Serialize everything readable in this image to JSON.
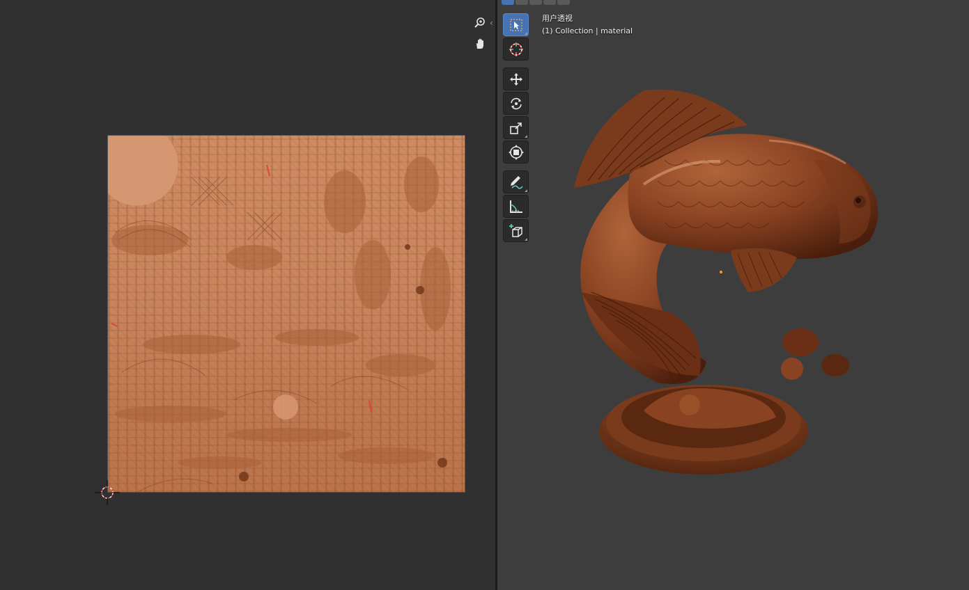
{
  "uv_editor": {
    "tools": [
      {
        "icon": "zoom-icon"
      },
      {
        "icon": "hand-pan-icon"
      }
    ],
    "collapse_icon": "chevron-left-icon",
    "texture_image": "baked-texture-atlas",
    "cursor_icon": "2d-cursor-icon"
  },
  "viewport": {
    "view_name": "用户透视",
    "collection_line": "(1) Collection | material",
    "toolbar": [
      {
        "icon": "select-box-icon",
        "active": true
      },
      {
        "icon": "cursor-icon"
      },
      {
        "icon": "move-icon"
      },
      {
        "icon": "rotate-icon"
      },
      {
        "icon": "scale-icon"
      },
      {
        "icon": "transform-icon"
      },
      {
        "icon": "annotate-icon"
      },
      {
        "icon": "measure-icon"
      },
      {
        "icon": "add-cube-icon"
      }
    ],
    "object": "koi-fish-sculpture",
    "colors": {
      "accent": "#4772b3",
      "origin": "#ff9a1f",
      "model": "#7a3a1c"
    }
  }
}
